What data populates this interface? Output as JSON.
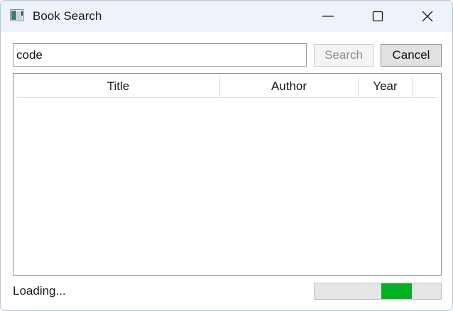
{
  "window": {
    "title": "Book Search",
    "icon": "app-window-icon",
    "controls": {
      "minimize_icon": "minimize-icon",
      "maximize_icon": "maximize-icon",
      "close_icon": "close-icon"
    }
  },
  "search": {
    "value": "code"
  },
  "buttons": {
    "search_label": "Search",
    "cancel_label": "Cancel"
  },
  "results": {
    "columns": [
      "Title",
      "Author",
      "Year"
    ],
    "rows": []
  },
  "status": {
    "text": "Loading...",
    "progress_marquee": {
      "start_fraction": 0.53,
      "end_fraction": 0.77
    }
  },
  "colors": {
    "titlebar": "#eef2f9",
    "progress_fill": "#06b025",
    "progress_track": "#e6e6e6",
    "disabled_text": "#8c8c8c"
  }
}
